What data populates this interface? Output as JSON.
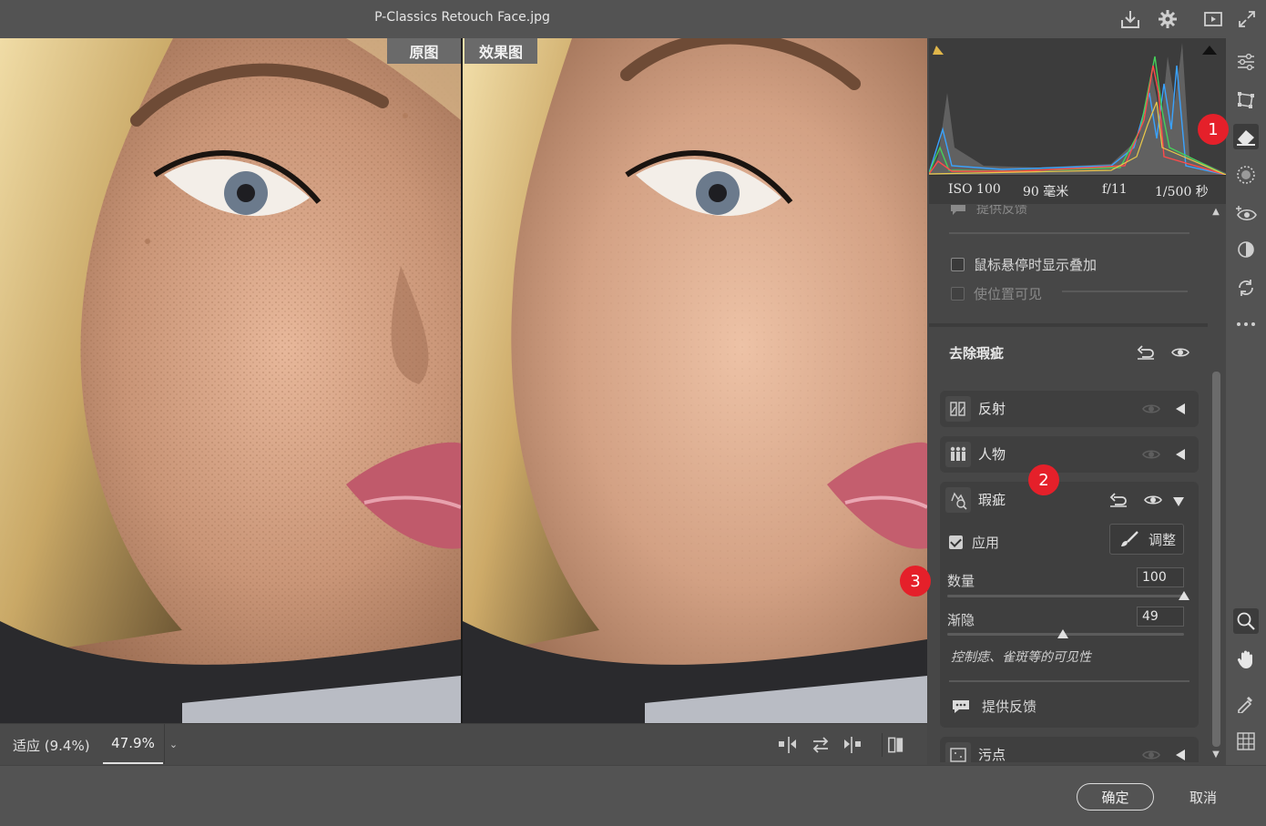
{
  "window": {
    "title": "P-Classics Retouch Face.jpg"
  },
  "titlebar_icons": [
    "save-download-icon",
    "gear-icon",
    "slideshow-play-icon",
    "fullscreen-expand-icon"
  ],
  "compare": {
    "before_label": "原图",
    "after_label": "效果图"
  },
  "status": {
    "zoom_fit": "适应 (9.4%)",
    "zoom_current": "47.9%",
    "zoom_dropdown": "⌄"
  },
  "exif": {
    "iso": "ISO 100",
    "focal": "90 毫米",
    "aperture": "f/11",
    "shutter": "1/500 秒"
  },
  "panel": {
    "faded_feedback": "提供反馈",
    "hover_overlay_label": "鼠标悬停时显示叠加",
    "location_visible_label": "使位置可见",
    "section_title": "去除瑕疵",
    "items": [
      {
        "label": "反射"
      },
      {
        "label": "人物"
      },
      {
        "label": "瑕疵"
      }
    ],
    "blemish": {
      "apply_label": "应用",
      "apply_checked": true,
      "adjust_label": "调整",
      "amount_label": "数量",
      "amount_value": "100",
      "amount": 100,
      "fade_label": "渐隐",
      "fade_value": "49",
      "fade": 49,
      "hint": "控制痣、雀斑等的可见性",
      "feedback_label": "提供反馈"
    },
    "spots_label": "污点"
  },
  "badges": [
    "1",
    "2",
    "3"
  ],
  "actions": {
    "ok": "确定",
    "cancel": "取消"
  },
  "colors": {
    "badge": "#e5202a",
    "panel_bg": "#474747",
    "app_bg": "#535353"
  }
}
